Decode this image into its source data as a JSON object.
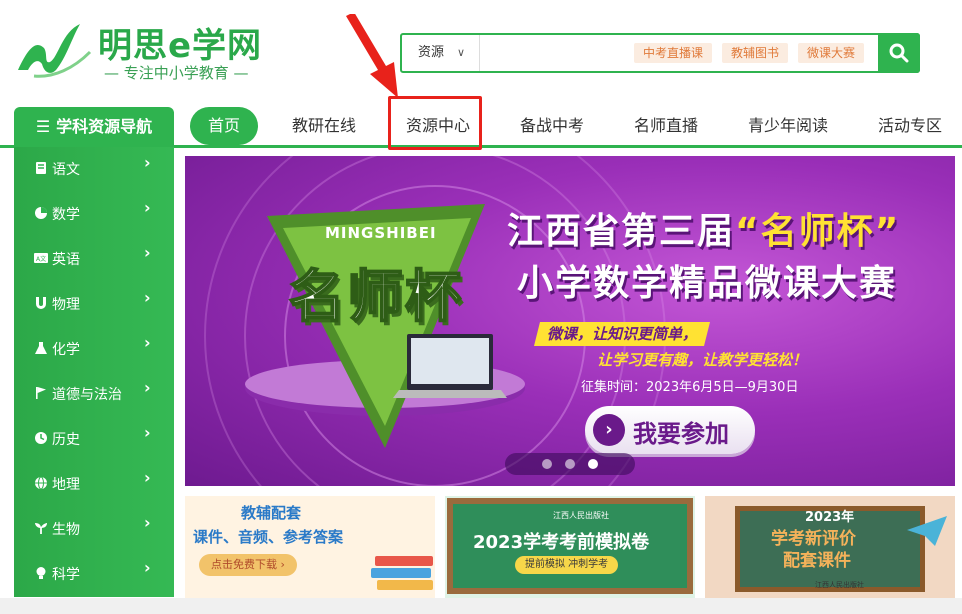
{
  "header": {
    "logo_name": "明思e学网",
    "logo_slogan": "— 专注中小学教育 —",
    "brand_color": "#2fb34f"
  },
  "search": {
    "type_label": "资源",
    "placeholder": "",
    "tags": [
      "中考直播课",
      "教辅图书",
      "微课大赛"
    ]
  },
  "nav": {
    "category_label": "学科资源导航",
    "items": [
      "首页",
      "教研在线",
      "资源中心",
      "备战中考",
      "名师直播",
      "青少年阅读",
      "活动专区"
    ],
    "active_index": 0,
    "highlighted_index": 2
  },
  "sidebar": {
    "items": [
      {
        "label": "语文",
        "icon": "book-icon"
      },
      {
        "label": "数学",
        "icon": "pie-chart-icon"
      },
      {
        "label": "英语",
        "icon": "translate-icon"
      },
      {
        "label": "物理",
        "icon": "magnet-icon"
      },
      {
        "label": "化学",
        "icon": "flask-icon"
      },
      {
        "label": "道德与法治",
        "icon": "flag-icon"
      },
      {
        "label": "历史",
        "icon": "clock-icon"
      },
      {
        "label": "地理",
        "icon": "globe-icon"
      },
      {
        "label": "生物",
        "icon": "sprout-icon"
      },
      {
        "label": "科学",
        "icon": "bulb-icon"
      }
    ],
    "chevron": "›"
  },
  "banner": {
    "badge_en": "MINGSHIBEI",
    "badge_cn": "名师杯",
    "title1_prefix": "江西省第三届",
    "title1_highlight": "“名师杯”",
    "title2": "小学数学精品微课大赛",
    "slogan1": "微课，让知识更简单，",
    "slogan2": "让学习更有趣，让教学更轻松！",
    "date": "征集时间：2023年6月5日—9月30日",
    "button_label": "我要参加",
    "slide_count": 3,
    "active_slide": 2
  },
  "cards": {
    "card1": {
      "title": "教辅配套",
      "subtitle": "课件、音频、参考答案",
      "button": "点击免费下载 ›"
    },
    "card2": {
      "publisher": "江西人民出版社",
      "title": "2023学考考前模拟卷",
      "subtitle": "提前模拟 冲刺学考"
    },
    "card3": {
      "year": "2023年",
      "title": "学考新评价",
      "subtitle": "配套课件",
      "publisher": "江西人民出版社"
    }
  }
}
